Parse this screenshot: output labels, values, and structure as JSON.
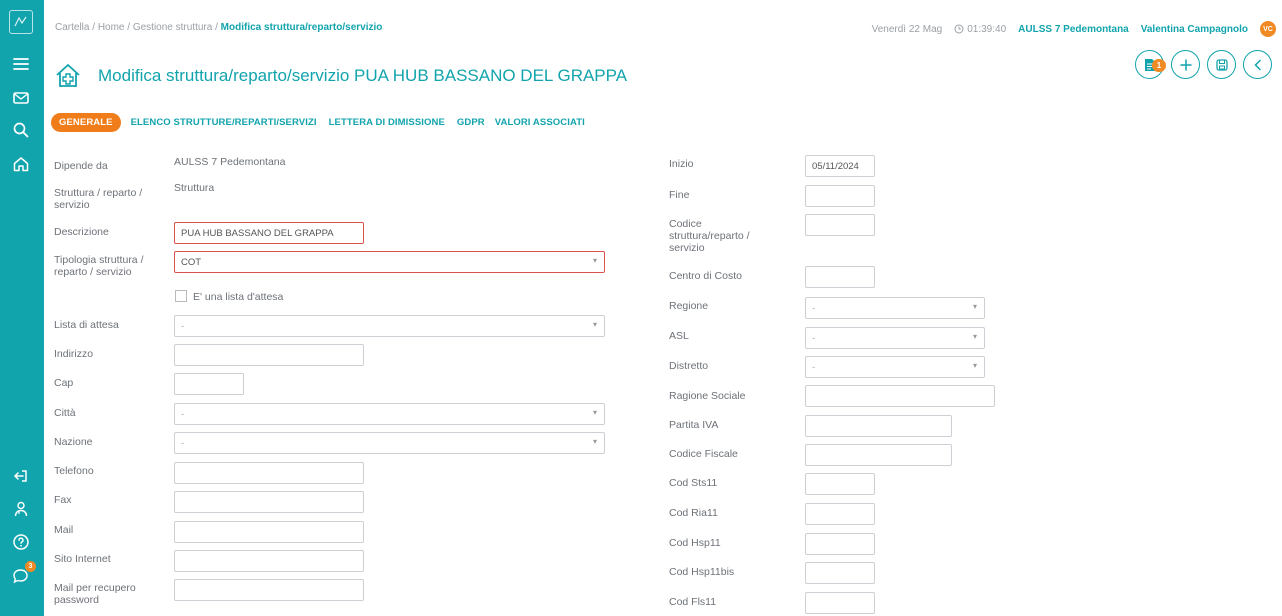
{
  "sidebar": {
    "badge_count": "3"
  },
  "breadcrumb": {
    "items": [
      "Cartella",
      "Home",
      "Gestione struttura"
    ],
    "current": "Modifica struttura/reparto/servizio",
    "sep": " / "
  },
  "topbar": {
    "date": "Venerdì 22 Mag",
    "time": "01:39:40",
    "org": "AULSS 7 Pedemontana",
    "user": "Valentina Campagnolo",
    "initials": "VC"
  },
  "page": {
    "title": "Modifica struttura/reparto/servizio PUA HUB BASSANO DEL GRAPPA"
  },
  "actions": {
    "badge": "1"
  },
  "tabs": [
    "GENERALE",
    "ELENCO STRUTTURE/REPARTI/SERVIZI",
    "LETTERA DI DIMISSIONE",
    "GDPR",
    "VALORI ASSOCIATI"
  ],
  "left": {
    "dipende_da": {
      "label": "Dipende da",
      "value": "AULSS 7 Pedemontana"
    },
    "struttura": {
      "label": "Struttura / reparto / servizio",
      "value": "Struttura"
    },
    "descrizione": {
      "label": "Descrizione",
      "value": "PUA HUB BASSANO DEL GRAPPA"
    },
    "tipologia": {
      "label": "Tipologia struttura / reparto / servizio",
      "value": "COT"
    },
    "lista_checkbox": {
      "label": "E' una lista d'attesa"
    },
    "lista_attesa": {
      "label": "Lista di attesa",
      "value": "-"
    },
    "indirizzo": {
      "label": "Indirizzo",
      "value": ""
    },
    "cap": {
      "label": "Cap",
      "value": ""
    },
    "citta": {
      "label": "Città",
      "value": "-"
    },
    "nazione": {
      "label": "Nazione",
      "value": "-"
    },
    "telefono": {
      "label": "Telefono",
      "value": ""
    },
    "fax": {
      "label": "Fax",
      "value": ""
    },
    "mail": {
      "label": "Mail",
      "value": ""
    },
    "sito": {
      "label": "Sito Internet",
      "value": ""
    },
    "mail_recupero": {
      "label": "Mail per recupero password",
      "value": ""
    }
  },
  "right": {
    "inizio": {
      "label": "Inizio",
      "value": "05/11/2024"
    },
    "fine": {
      "label": "Fine",
      "value": ""
    },
    "codice": {
      "label": "Codice struttura/reparto / servizio",
      "value": ""
    },
    "centro_costo": {
      "label": "Centro di Costo",
      "value": ""
    },
    "regione": {
      "label": "Regione",
      "value": "-"
    },
    "asl": {
      "label": "ASL",
      "value": "-"
    },
    "distretto": {
      "label": "Distretto",
      "value": "-"
    },
    "ragione_sociale": {
      "label": "Ragione Sociale",
      "value": ""
    },
    "partita_iva": {
      "label": "Partita IVA",
      "value": ""
    },
    "codice_fiscale": {
      "label": "Codice Fiscale",
      "value": ""
    },
    "cod_sts11": {
      "label": "Cod Sts11",
      "value": ""
    },
    "cod_ria11": {
      "label": "Cod Ria11",
      "value": ""
    },
    "cod_hsp11": {
      "label": "Cod Hsp11",
      "value": ""
    },
    "cod_hsp11bis": {
      "label": "Cod Hsp11bis",
      "value": ""
    },
    "cod_fls11": {
      "label": "Cod Fls11",
      "value": ""
    }
  },
  "colors": {
    "primary": "#12a4ad",
    "accent": "#f07d1a",
    "error": "#d9534f"
  }
}
